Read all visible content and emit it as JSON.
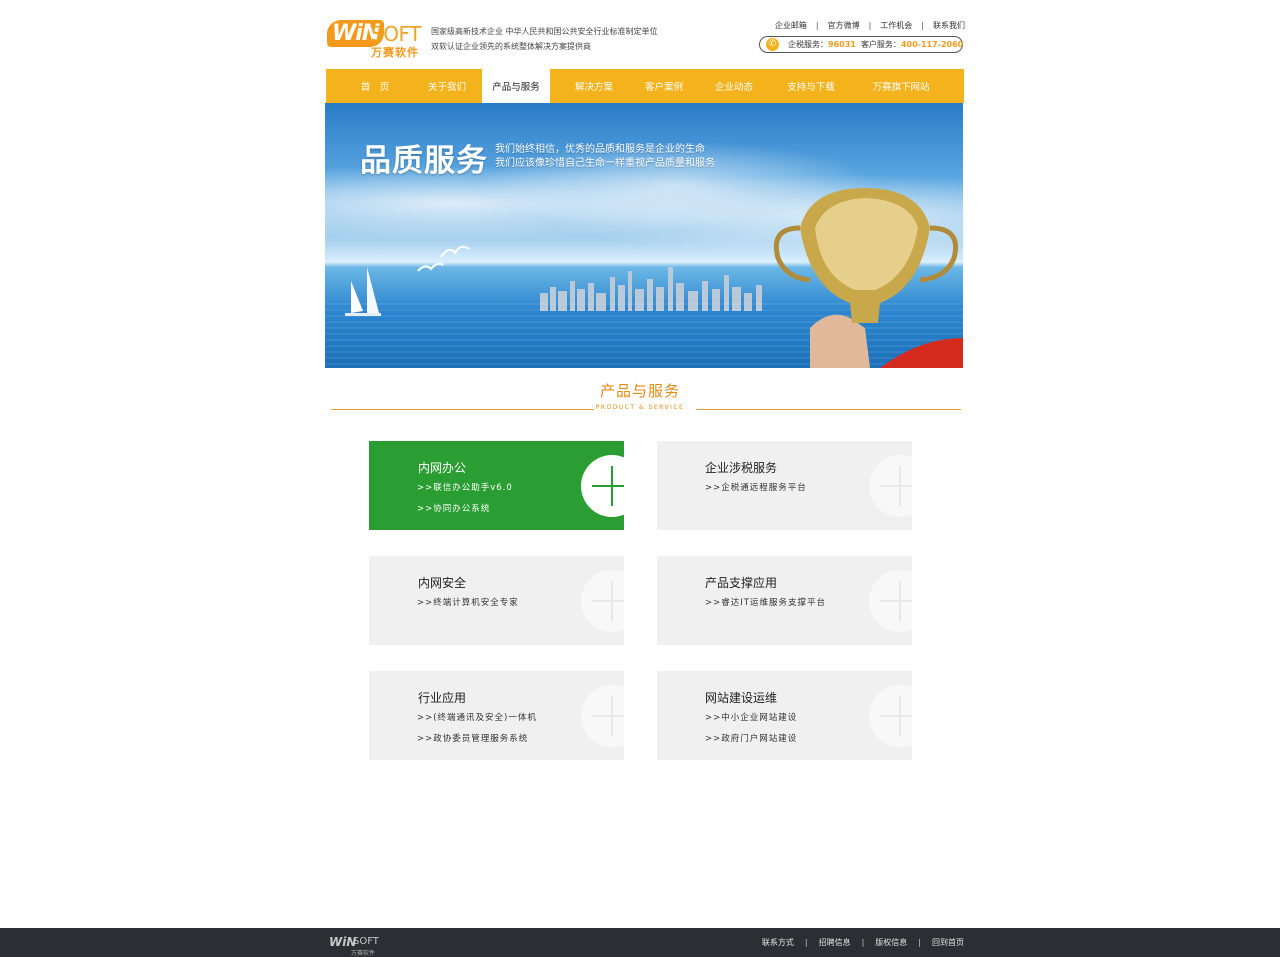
{
  "header": {
    "logo_win": "WiN",
    "logo_soft": "SOFT",
    "logo_cn": "万赛软件",
    "tagline_line1": "国家级高新技术企业  中华人民共和国公共安全行业标准制定单位",
    "tagline_line2": "双软认证企业领先的系统整体解决方案提供商",
    "top_links": [
      "企业邮箱",
      "官方微博",
      "工作机会",
      "联系我们"
    ],
    "phone_label1": "企税服务：",
    "phone_num1": "96031",
    "phone_label2": "客户服务：",
    "phone_num2": "400-117-2060"
  },
  "nav": {
    "items": [
      "首　页",
      "关于我们",
      "产品与服务",
      "解决方案",
      "客户案例",
      "企业动态",
      "支持与下载",
      "万赛旗下网站"
    ],
    "active_index": 2
  },
  "banner": {
    "title": "品质服务",
    "line1": "我们始终相信，优秀的品质和服务是企业的生命",
    "line2": "我们应该像珍惜自己生命一样重视产品质量和服务"
  },
  "section": {
    "title": "产品与服务",
    "subtitle": "PRODUCT & SERVICE"
  },
  "cards": [
    {
      "title": "内网办公",
      "links": [
        ">>联信办公助手v6.0",
        ">>协同办公系统"
      ],
      "active": true
    },
    {
      "title": "企业涉税服务",
      "links": [
        ">>企税通远程服务平台"
      ],
      "active": false
    },
    {
      "title": "内网安全",
      "links": [
        ">>终端计算机安全专家"
      ],
      "active": false
    },
    {
      "title": "产品支撑应用",
      "links": [
        ">>睿达IT运维服务支撑平台"
      ],
      "active": false
    },
    {
      "title": "行业应用",
      "links": [
        ">>(终端通讯及安全)一体机",
        ">>政协委员管理服务系统"
      ],
      "active": false
    },
    {
      "title": "网站建设运维",
      "links": [
        ">>中小企业网站建设",
        ">>政府门户网站建设"
      ],
      "active": false
    }
  ],
  "footer": {
    "logo_win": "WiN",
    "logo_soft": "SOFT",
    "logo_cn": "万赛软件",
    "links": [
      "联系方式",
      "招聘信息",
      "版权信息",
      "回到首页"
    ]
  },
  "colors": {
    "accent_orange": "#f4b21d",
    "heading_orange": "#e58a12",
    "active_green": "#2a9d33",
    "footer_bg": "#2b2e33"
  }
}
